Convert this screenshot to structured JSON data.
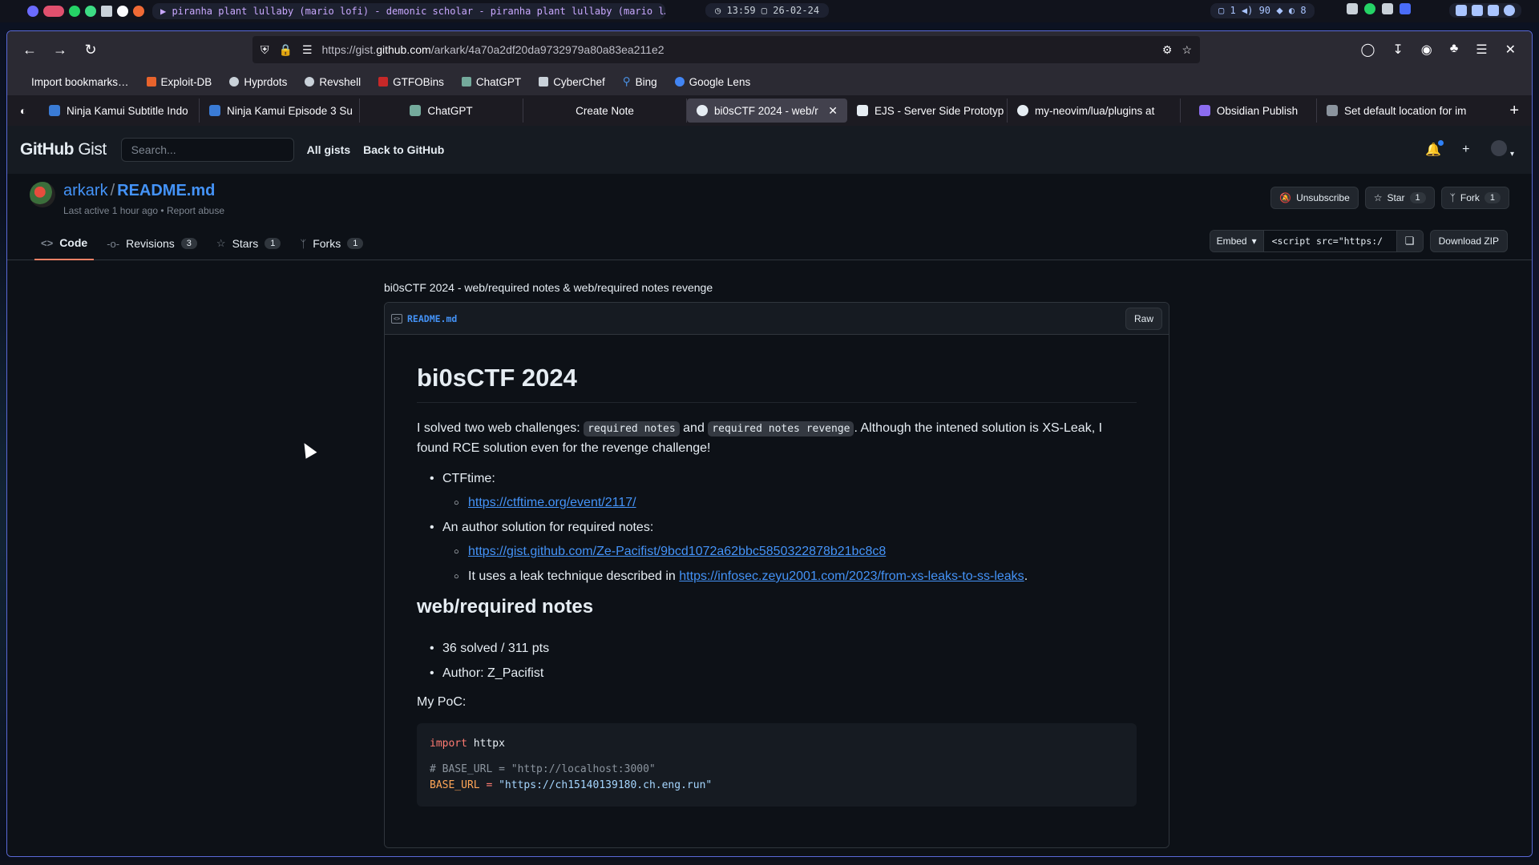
{
  "system": {
    "media": "▶ piranha plant lullaby (mario lofi) - demonic scholar - piranha plant lullaby (mario l…",
    "clock": "◷ 13:59 ▢ 26-02-24",
    "status": "▢ 1  ◀) 90  ⬥  ◐ 8"
  },
  "browser": {
    "url_prefix": "https://gist.",
    "url_main": "github.com",
    "url_suffix": "/arkark/4a70a2df20da9732979a80a83ea211e2",
    "bookmarks": [
      {
        "label": "Import bookmarks…",
        "color": "#9aa0a6"
      },
      {
        "label": "Exploit-DB",
        "color": "#e8632c"
      },
      {
        "label": "Hyprdots",
        "color": "#c9d1d9"
      },
      {
        "label": "Revshell",
        "color": "#c9d1d9"
      },
      {
        "label": "GTFOBins",
        "color": "#c62828"
      },
      {
        "label": "ChatGPT",
        "color": "#74aa9c"
      },
      {
        "label": "CyberChef",
        "color": "#c9d1d9"
      },
      {
        "label": "Bing",
        "color": "#4a90e2"
      },
      {
        "label": "Google Lens",
        "color": "#4285f4"
      }
    ],
    "tabs": [
      {
        "label": "Ninja Kamui Subtitle Indo",
        "color": "#3a7bd5",
        "width": 200
      },
      {
        "label": "Ninja Kamui Episode 3 Su",
        "color": "#3a7bd5",
        "width": 200
      },
      {
        "label": "ChatGPT",
        "color": "#74aa9c",
        "width": 204
      },
      {
        "label": "Create Note",
        "color": "transparent",
        "width": 204
      },
      {
        "label": "bi0sCTF 2024 - web/r",
        "color": "#e6edf3",
        "width": 200,
        "active": true
      },
      {
        "label": "EJS - Server Side Prototyp",
        "color": "#e6edf3",
        "width": 200
      },
      {
        "label": "my-neovim/lua/plugins at",
        "color": "#e6edf3",
        "width": 216
      },
      {
        "label": "Obsidian Publish",
        "color": "#8b6cef",
        "width": 170
      },
      {
        "label": "Set default location for im",
        "color": "#8b949e",
        "width": 220
      }
    ]
  },
  "github": {
    "logo_bold": "GitHub",
    "logo_light": "Gist",
    "search_placeholder": "Search...",
    "nav_all_gists": "All gists",
    "nav_back": "Back to GitHub",
    "owner": "arkark",
    "file_title": "README.md",
    "meta": "Last active 1 hour ago • Report abuse",
    "unsubscribe": "Unsubscribe",
    "star": "Star",
    "star_count": "1",
    "fork": "Fork",
    "fork_count": "1",
    "tabs": {
      "code": "Code",
      "revisions": "Revisions",
      "revisions_count": "3",
      "stars": "Stars",
      "stars_count": "1",
      "forks": "Forks",
      "forks_count": "1"
    },
    "embed": "Embed",
    "embed_value": "<script src=\"https:/",
    "download": "Download ZIP"
  },
  "gist": {
    "description": "bi0sCTF 2024 - web/required notes & web/required notes revenge",
    "filename": "README.md",
    "raw": "Raw",
    "h1": "bi0sCTF 2024",
    "intro_1": "I solved two web challenges: ",
    "intro_code1": "required notes",
    "intro_and": " and ",
    "intro_code2": "required notes revenge",
    "intro_2": ". Although the intened solution is XS-Leak, I found RCE solution even for the revenge challenge!",
    "ctftime_label": "CTFtime:",
    "ctftime_url": "https://ctftime.org/event/2117/",
    "author_sol_label": "An author solution for required notes:",
    "author_sol_url": "https://gist.github.com/Ze-Pacifist/9bcd1072a62bbc5850322878b21bc8c8",
    "leak_text": "It uses a leak technique described in ",
    "leak_url": "https://infosec.zeyu2001.com/2023/from-xs-leaks-to-ss-leaks",
    "leak_end": ".",
    "h2": "web/required notes",
    "solved": "36 solved / 311 pts",
    "author": "Author: Z_Pacifist",
    "poc": "My PoC:",
    "code": {
      "import_kw": "import",
      "import_mod": " httpx",
      "comment": "# BASE_URL = \"http://localhost:3000\"",
      "var": "BASE_URL",
      "eq": " = ",
      "str": "\"https://ch15140139180.ch.eng.run\""
    }
  }
}
